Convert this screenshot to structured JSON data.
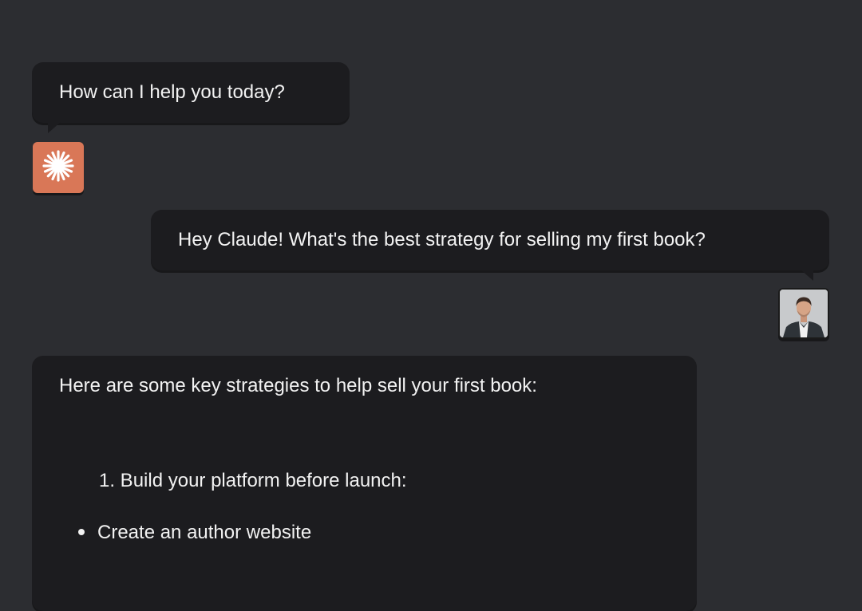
{
  "conversation": {
    "assistant_greeting": "How can I help you today?",
    "user_message": "Hey Claude! What's the best strategy for selling my first book?",
    "assistant_reply": {
      "intro": "Here are some key strategies to help sell your first book:",
      "numbered_item": "1. Build your platform before launch:",
      "bullet_item": "Create an author website"
    }
  },
  "avatars": {
    "assistant_icon": "starburst-icon",
    "user_icon": "user-photo"
  },
  "colors": {
    "background": "#2c2d31",
    "bubble": "#1c1c1f",
    "assistant_avatar": "#d97757",
    "text": "#f2f2f2"
  }
}
